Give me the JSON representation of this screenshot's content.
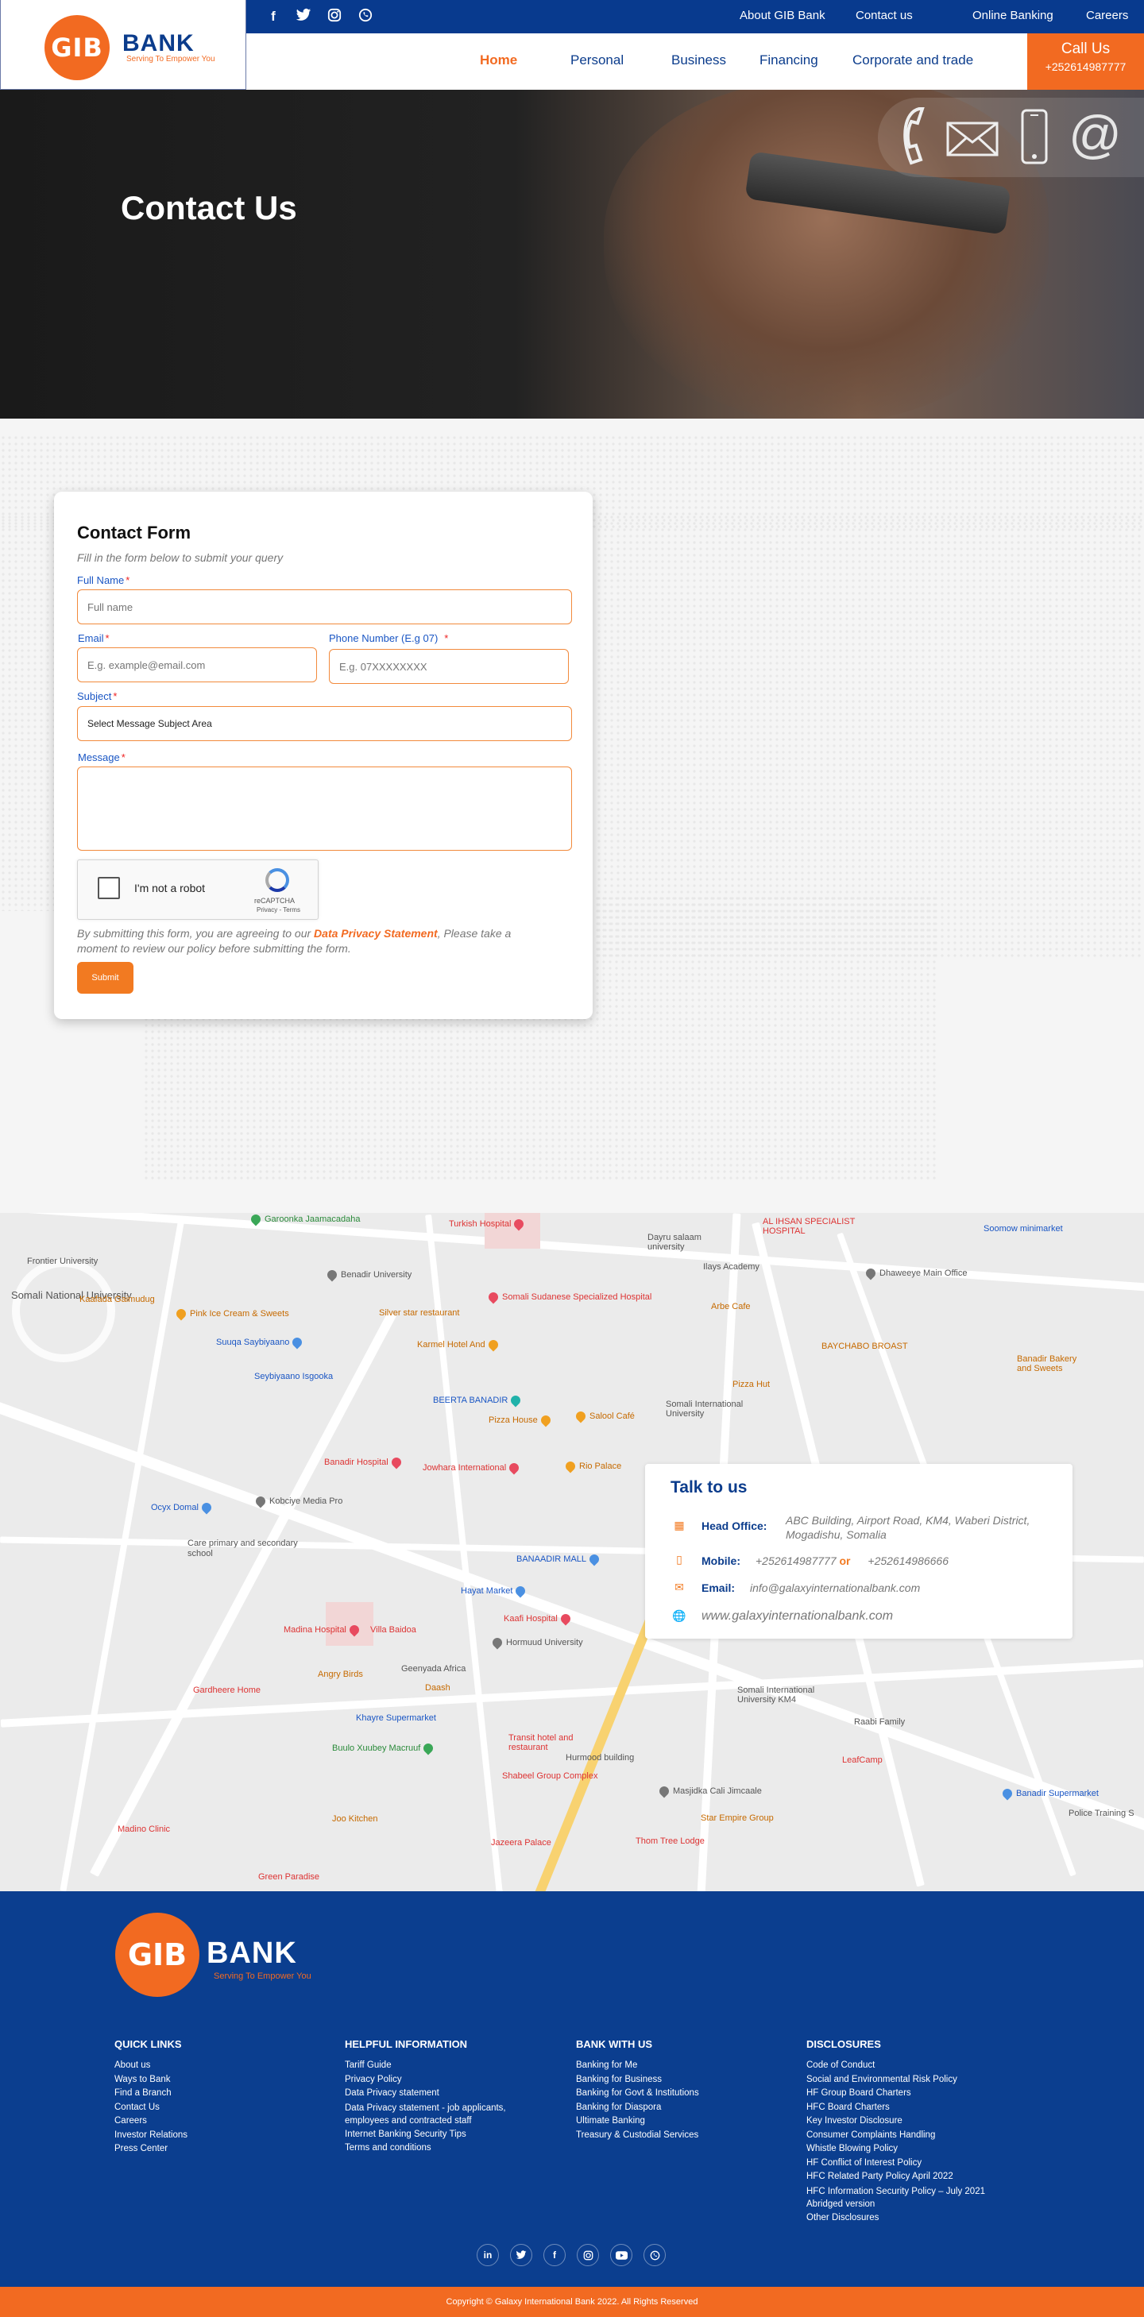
{
  "brand": {
    "logo_mark": "GIB",
    "name": "BANK",
    "tagline": "Serving To Empower You"
  },
  "colors": {
    "primary_blue": "#0b3c8c",
    "accent_orange": "#f26a21"
  },
  "topbar": {
    "social_icons": [
      "facebook-icon",
      "twitter-icon",
      "instagram-icon",
      "whatsapp-icon"
    ],
    "links": [
      "About GIB  Bank",
      "Contact us",
      "Online Banking",
      "Careers"
    ]
  },
  "nav": {
    "items": [
      "Home",
      "Personal",
      "Business",
      "Financing",
      "Corporate and trade"
    ],
    "active": "Home"
  },
  "call": {
    "label": "Call Us",
    "phone": "+252614987777"
  },
  "hero": {
    "title": "Contact Us",
    "icons": [
      "phone-icon",
      "envelope-icon",
      "mobile-icon",
      "at-icon"
    ]
  },
  "form": {
    "title": "Contact Form",
    "subtitle": "Fill in the form below to submit your query",
    "full_name": {
      "label": "Full Name",
      "placeholder": "Full name"
    },
    "email": {
      "label": "Email",
      "placeholder": "E.g. example@email.com"
    },
    "phone": {
      "label": "Phone Number (E.g 07)",
      "placeholder": "E.g. 07XXXXXXXX"
    },
    "subject": {
      "label": "Subject",
      "value": "Select Message Subject Area"
    },
    "message": {
      "label": "Message"
    },
    "required_mark": "*",
    "captcha": {
      "label": "I'm not a robot",
      "brand": "reCAPTCHA",
      "terms": "Privacy - Terms"
    },
    "consent_pre": "By submitting this form, you are agreeing to our ",
    "consent_link": "Data Privacy Statement",
    "consent_post": ", Please take a moment to review our policy before submitting the form.",
    "submit": "Submit"
  },
  "map": {
    "places": [
      "Somali National University",
      "Benadir University",
      "Turkish Hospital",
      "Somali Sudanese Specialized Hospital",
      "Silver star restaurant",
      "Karmel Hotel And",
      "Pink Ice Cream & Sweets",
      "Kaafada Gaimudug",
      "Suuqa Saybiyaano",
      "Seybiyaano Isgooka",
      "BEERTA BANADIR",
      "Pizza House",
      "Salool Café",
      "Banadir Hospital",
      "Jowhara International",
      "Rio Palace",
      "Kobciye Media Pro",
      "Ocyx Domal",
      "Care primary and secondary school",
      "BANAADIR MALL",
      "Hayat Market",
      "Madina Hospital",
      "Villa Baidoa",
      "Kaafi Hospital",
      "Hormuud University",
      "Angry Birds",
      "Geenyada Africa",
      "Daash",
      "Gardheere Home",
      "Khayre Supermarket",
      "Buulo Xuubey Macruuf",
      "Transit hotel and restaurant",
      "Shabeel Group Complex",
      "Hurmood building",
      "Masjidka Cali Jimcaale",
      "Jazeera Palace",
      "Thom Tree Lodge",
      "Star Empire Group",
      "Joo Kitchen",
      "Madino Clinic",
      "Green Paradise",
      "Frontier University",
      "Dayru salaam university",
      "AL IHSAN SPECIALIST HOSPITAL",
      "Soomow minimarket",
      "Ilays Academy",
      "Arbe Cafe",
      "Pizza Hut",
      "Somali International University",
      "BAYCHABO BROAST",
      "Banadir Bakery and Sweets",
      "Somali International University KM4",
      "Raabi Family",
      "LeafCamp",
      "Banadir Supermarket",
      "Police Training S",
      "Garoonka Jaamacadaha",
      "Dhaweeye Main Office"
    ]
  },
  "contact": {
    "title": "Talk to us",
    "head_office_label": "Head Office:",
    "head_office_value": "ABC Building, Airport Road, KM4, Waberi District, Mogadishu, Somalia",
    "mobile_label": "Mobile:",
    "mobile_1": "+252614987777",
    "mobile_or": "or",
    "mobile_2": "+252614986666",
    "email_label": "Email:",
    "email_value": "info@galaxyinternationalbank.com",
    "website": "www.galaxyinternationalbank.com"
  },
  "footer": {
    "columns": [
      {
        "title": "QUICK LINKS",
        "links": [
          "About us",
          "Ways to Bank",
          "Find a Branch",
          "Contact Us",
          "Careers",
          "Investor Relations",
          "Press Center"
        ]
      },
      {
        "title": "HELPFUL INFORMATION",
        "links": [
          "Tariff Guide",
          "Privacy Policy",
          "Data Privacy statement",
          "Data Privacy statement - job applicants, employees and contracted staff",
          "Internet Banking Security Tips",
          "Terms and conditions"
        ]
      },
      {
        "title": "BANK WITH US",
        "links": [
          "Banking for Me",
          "Banking for Business",
          "Banking for Govt & Institutions",
          "Banking for Diaspora",
          "Ultimate Banking",
          "Treasury & Custodial Services"
        ]
      },
      {
        "title": "DISCLOSURES",
        "links": [
          "Code of Conduct",
          "Social and Environmental Risk Policy",
          "HF Group Board Charters",
          "HFC Board Charters",
          "Key Investor Disclosure",
          "Consumer Complaints Handling",
          "Whistle Blowing Policy",
          "HF Conflict of Interest Policy",
          "HFC Related Party Policy April 2022",
          "HFC Information Security Policy – July 2021 Abridged version",
          "Other Disclosures"
        ]
      }
    ],
    "social_icons": [
      "linkedin-icon",
      "twitter-icon",
      "facebook-icon",
      "instagram-icon",
      "youtube-icon",
      "whatsapp-icon"
    ],
    "copyright": "Copyright © Galaxy International Bank 2022. All Rights Reserved"
  }
}
